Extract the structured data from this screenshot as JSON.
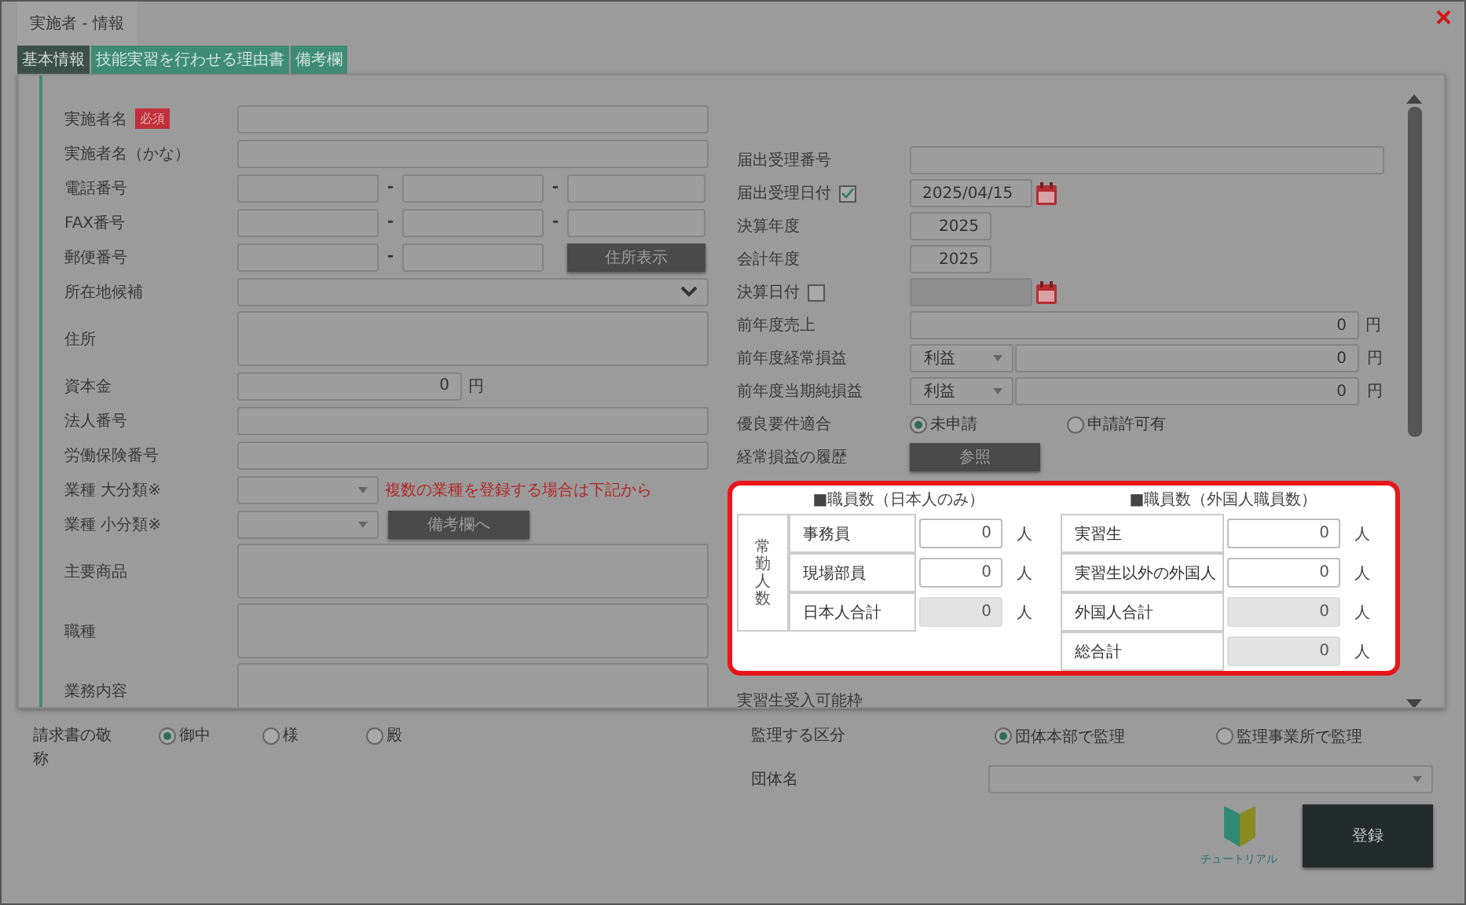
{
  "window": {
    "title": "実施者 - 情報",
    "close": "×"
  },
  "tabs": [
    {
      "label": "基本情報",
      "selected": true
    },
    {
      "label": "技能実習を行わせる理由書",
      "selected": false
    },
    {
      "label": "備考欄",
      "selected": false
    }
  ],
  "left_fields": [
    {
      "kind": "text",
      "label": "実施者名",
      "badge": "必須"
    },
    {
      "kind": "text",
      "label": "実施者名（かな）"
    },
    {
      "kind": "triple",
      "label": "電話番号",
      "separator": "-"
    },
    {
      "kind": "triple",
      "label": "FAX番号",
      "separator": "-"
    },
    {
      "kind": "postal",
      "label": "郵便番号",
      "separator": "-",
      "button": "住所表示"
    },
    {
      "kind": "select",
      "label": "所在地候補"
    },
    {
      "kind": "textarea",
      "label": "住所"
    },
    {
      "kind": "money",
      "label": "資本金",
      "value": "0",
      "unit": "円"
    },
    {
      "kind": "text",
      "label": "法人番号"
    },
    {
      "kind": "text",
      "label": "労働保険番号"
    },
    {
      "kind": "select_note",
      "label": "業種 大分類※",
      "note": "複数の業種を登録する場合は下記から"
    },
    {
      "kind": "select_button",
      "label": "業種 小分類※",
      "button": "備考欄へ"
    },
    {
      "kind": "textarea",
      "label": "主要商品"
    },
    {
      "kind": "textarea",
      "label": "職種"
    },
    {
      "kind": "textarea",
      "label": "業務内容"
    }
  ],
  "right_fields": [
    {
      "kind": "text",
      "label": "届出受理番号"
    },
    {
      "kind": "date",
      "label": "届出受理日付",
      "checked": true,
      "value": "2025/04/15"
    },
    {
      "kind": "year",
      "label": "決算年度",
      "value": "2025"
    },
    {
      "kind": "year",
      "label": "会計年度",
      "value": "2025"
    },
    {
      "kind": "date",
      "label": "決算日付",
      "checked": false
    },
    {
      "kind": "money",
      "label": "前年度売上",
      "value": "0",
      "unit": "円"
    },
    {
      "kind": "profit",
      "label": "前年度経常損益",
      "choice": "利益",
      "value": "0",
      "unit": "円"
    },
    {
      "kind": "profit",
      "label": "前年度当期純損益",
      "choice": "利益",
      "value": "0",
      "unit": "円"
    },
    {
      "kind": "radio",
      "label": "優良要件適合",
      "options": [
        {
          "label": "未申請",
          "selected": true
        },
        {
          "label": "申請許可有",
          "selected": false
        }
      ]
    },
    {
      "kind": "button",
      "label": "経常損益の履歴",
      "button": "参照"
    }
  ],
  "staff_panel": {
    "japanese": {
      "heading": "■職員数（日本人のみ）",
      "side_label": "常勤人数",
      "rows": [
        {
          "label": "事務員",
          "value": "0",
          "unit": "人",
          "readonly": false
        },
        {
          "label": "現場部員",
          "value": "0",
          "unit": "人",
          "readonly": false
        },
        {
          "label": "日本人合計",
          "value": "0",
          "unit": "人",
          "readonly": true
        }
      ]
    },
    "foreign": {
      "heading": "■職員数（外国人職員数）",
      "rows": [
        {
          "label": "実習生",
          "value": "0",
          "unit": "人",
          "readonly": false
        },
        {
          "label": "実習生以外の外国人",
          "value": "0",
          "unit": "人",
          "readonly": false
        },
        {
          "label": "外国人合計",
          "value": "0",
          "unit": "人",
          "readonly": true
        },
        {
          "label": "総合計",
          "value": "0",
          "unit": "人",
          "readonly": true
        }
      ]
    }
  },
  "trailing_label": "実習生受入可能枠",
  "honorific": {
    "label": "請求書の敬称",
    "options": [
      {
        "label": "御中",
        "selected": true
      },
      {
        "label": "様",
        "selected": false
      },
      {
        "label": "殿",
        "selected": false
      }
    ]
  },
  "supervision": {
    "label": "監理する区分",
    "options": [
      {
        "label": "団体本部で監理",
        "selected": true
      },
      {
        "label": "監理事業所で監理",
        "selected": false
      }
    ]
  },
  "group": {
    "label": "団体名"
  },
  "tutorial": {
    "label": "チュートリアル"
  },
  "submit": {
    "label": "登録"
  }
}
